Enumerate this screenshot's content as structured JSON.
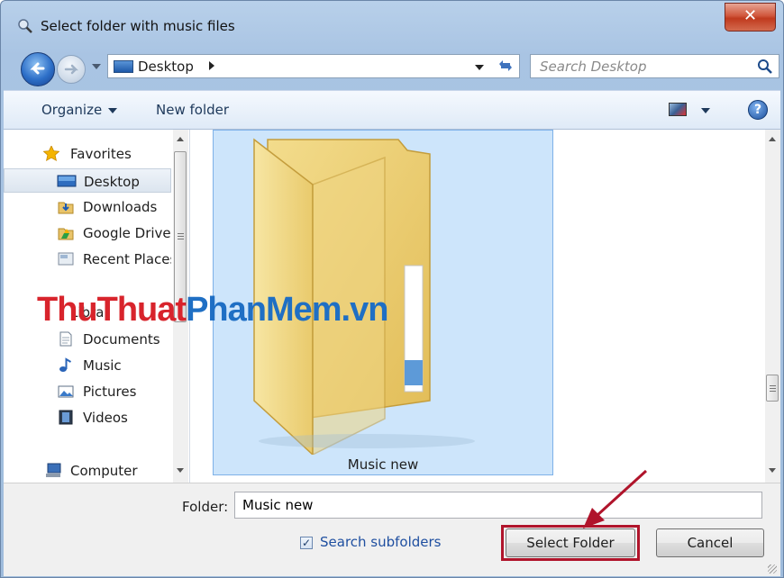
{
  "window": {
    "title": "Select folder with music files",
    "close_glyph": "✕"
  },
  "nav": {
    "address_path": "Desktop",
    "search_placeholder": "Search Desktop"
  },
  "commandbar": {
    "organize": "Organize",
    "new_folder": "New folder",
    "help": "?"
  },
  "sidebar": {
    "items": [
      {
        "label": "Favorites",
        "icon": "star-icon"
      },
      {
        "label": "Desktop",
        "icon": "desktop-icon",
        "selected": true
      },
      {
        "label": "Downloads",
        "icon": "downloads-icon"
      },
      {
        "label": "Google Drive",
        "icon": "google-drive-icon"
      },
      {
        "label": "Recent Places",
        "icon": "recent-places-icon"
      },
      {
        "label": "Libraries",
        "icon": "libraries-icon"
      },
      {
        "label": "Documents",
        "icon": "documents-icon"
      },
      {
        "label": "Music",
        "icon": "music-icon"
      },
      {
        "label": "Pictures",
        "icon": "pictures-icon"
      },
      {
        "label": "Videos",
        "icon": "videos-icon"
      },
      {
        "label": "Computer",
        "icon": "computer-icon"
      }
    ]
  },
  "main": {
    "folder_name": "Music new"
  },
  "footer": {
    "folder_label": "Folder:",
    "folder_value": "Music new",
    "search_subfolders_label": "Search subfolders",
    "search_subfolders_checked": true,
    "select_button": "Select Folder",
    "cancel_button": "Cancel"
  },
  "watermark": {
    "part1": "ThuThuat",
    "part2": "PhanMem.vn"
  },
  "colors": {
    "highlight_outline": "#b0142b",
    "selection_fill": "#cde5fb",
    "watermark_red": "#d8242c",
    "watermark_blue": "#1f6fc4"
  }
}
